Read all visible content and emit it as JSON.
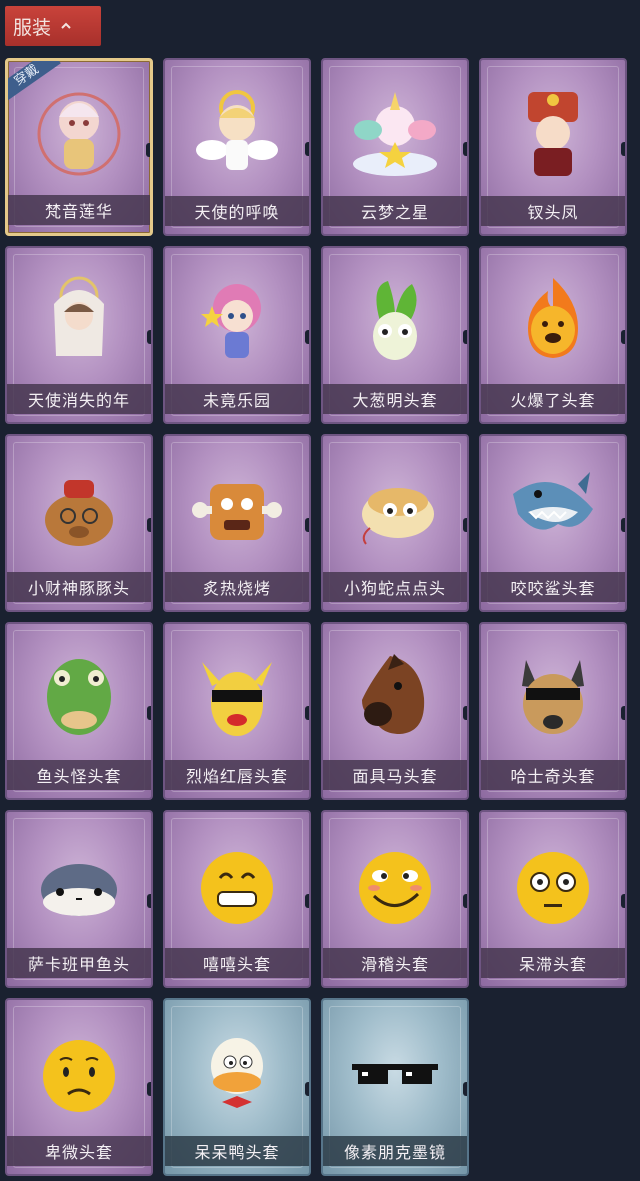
{
  "header": {
    "title": "服装"
  },
  "equipped_badge": "穿戴",
  "items": [
    {
      "name": "梵音莲华",
      "icon": "lotus-character-icon",
      "theme": "purple",
      "equipped": true
    },
    {
      "name": "天使的呼唤",
      "icon": "angel-character-icon",
      "theme": "purple",
      "equipped": false
    },
    {
      "name": "云梦之星",
      "icon": "unicorn-cloud-icon",
      "theme": "purple",
      "equipped": false
    },
    {
      "name": "钗头凤",
      "icon": "phoenix-crown-character-icon",
      "theme": "purple",
      "equipped": false
    },
    {
      "name": "天使消失的年",
      "icon": "veiled-angel-character-icon",
      "theme": "purple",
      "equipped": false
    },
    {
      "name": "未竟乐园",
      "icon": "pink-hair-character-icon",
      "theme": "purple",
      "equipped": false
    },
    {
      "name": "大葱明头套",
      "icon": "scallion-head-icon",
      "theme": "purple",
      "equipped": false
    },
    {
      "name": "火爆了头套",
      "icon": "fire-head-icon",
      "theme": "purple",
      "equipped": false
    },
    {
      "name": "小财神豚豚头",
      "icon": "capybara-head-icon",
      "theme": "purple",
      "equipped": false
    },
    {
      "name": "炙热烧烤",
      "icon": "bbq-meat-head-icon",
      "theme": "purple",
      "equipped": false
    },
    {
      "name": "小狗蛇点点头",
      "icon": "snake-head-icon",
      "theme": "purple",
      "equipped": false
    },
    {
      "name": "咬咬鲨头套",
      "icon": "shark-head-icon",
      "theme": "purple",
      "equipped": false
    },
    {
      "name": "鱼头怪头套",
      "icon": "fish-monster-head-icon",
      "theme": "purple",
      "equipped": false
    },
    {
      "name": "烈焰红唇头套",
      "icon": "yellow-mask-head-icon",
      "theme": "purple",
      "equipped": false
    },
    {
      "name": "面具马头套",
      "icon": "horse-mask-head-icon",
      "theme": "purple",
      "equipped": false
    },
    {
      "name": "哈士奇头套",
      "icon": "husky-head-icon",
      "theme": "purple",
      "equipped": false
    },
    {
      "name": "萨卡班甲鱼头",
      "icon": "sacabambaspis-head-icon",
      "theme": "purple",
      "equipped": false
    },
    {
      "name": "嘻嘻头套",
      "icon": "grin-emoji-head-icon",
      "theme": "purple",
      "equipped": false
    },
    {
      "name": "滑稽头套",
      "icon": "funny-emoji-head-icon",
      "theme": "purple",
      "equipped": false
    },
    {
      "name": "呆滞头套",
      "icon": "dull-emoji-head-icon",
      "theme": "purple",
      "equipped": false
    },
    {
      "name": "卑微头套",
      "icon": "humble-emoji-head-icon",
      "theme": "purple",
      "equipped": false
    },
    {
      "name": "呆呆鸭头套",
      "icon": "duck-head-icon",
      "theme": "blue",
      "equipped": false
    },
    {
      "name": "像素朋克墨镜",
      "icon": "pixel-sunglasses-icon",
      "theme": "blue",
      "equipped": false
    }
  ],
  "colors": {
    "background": "#1a2130",
    "header_tab": "#b83a33",
    "purple_card": "#b391c1",
    "blue_card": "#9fbcca",
    "equipped_border": "#e4c98a"
  }
}
